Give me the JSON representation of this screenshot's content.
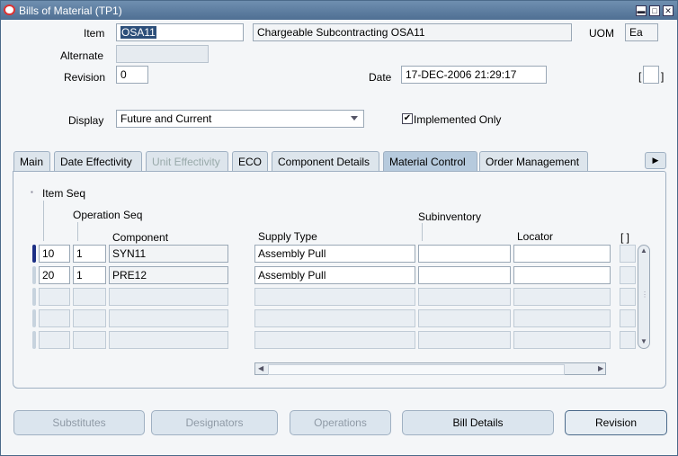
{
  "window": {
    "title": "Bills of Material (TP1)"
  },
  "header": {
    "item_label": "Item",
    "item_value": "OSA11",
    "item_description": "Chargeable Subcontracting OSA11",
    "uom_label": "UOM",
    "uom_value": "Ea",
    "alternate_label": "Alternate",
    "alternate_value": "",
    "revision_label": "Revision",
    "revision_value": "0",
    "date_label": "Date",
    "date_value": "17-DEC-2006 21:29:17",
    "display_label": "Display",
    "display_value": "Future and Current",
    "implemented_only_label": "Implemented Only",
    "implemented_only_checked": true
  },
  "tabs": [
    {
      "label": "Main",
      "state": "normal"
    },
    {
      "label": "Date Effectivity",
      "state": "normal"
    },
    {
      "label": "Unit Effectivity",
      "state": "disabled"
    },
    {
      "label": "ECO",
      "state": "normal"
    },
    {
      "label": "Component Details",
      "state": "normal"
    },
    {
      "label": "Material Control",
      "state": "active"
    },
    {
      "label": "Order Management",
      "state": "normal"
    }
  ],
  "grid": {
    "headers": {
      "item_seq": "Item Seq",
      "operation_seq": "Operation Seq",
      "component": "Component",
      "supply_type": "Supply Type",
      "subinventory": "Subinventory",
      "locator": "Locator",
      "flex": "[ ]"
    },
    "rows": [
      {
        "item_seq": "10",
        "operation_seq": "1",
        "component": "SYN11",
        "supply_type": "Assembly Pull",
        "subinventory": "",
        "locator": ""
      },
      {
        "item_seq": "20",
        "operation_seq": "1",
        "component": "PRE12",
        "supply_type": "Assembly Pull",
        "subinventory": "",
        "locator": ""
      }
    ]
  },
  "buttons": {
    "substitutes": "Substitutes",
    "designators": "Designators",
    "operations": "Operations",
    "bill_details": "Bill Details",
    "revision": "Revision"
  },
  "flex_field": "[ ]"
}
